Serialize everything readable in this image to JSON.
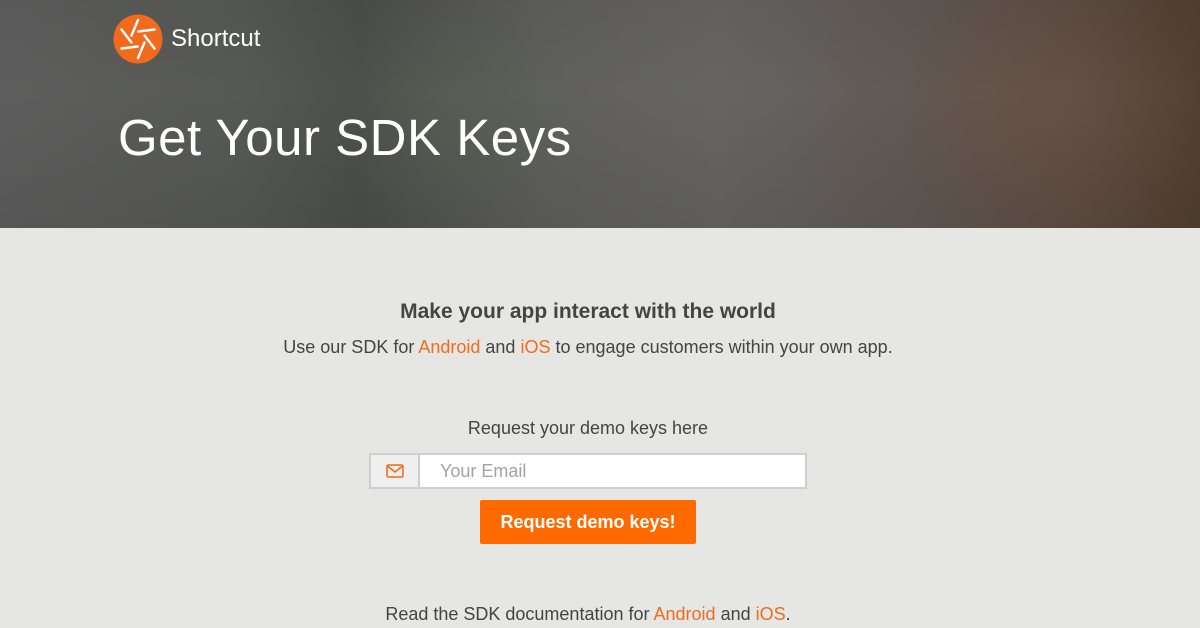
{
  "brand": {
    "name": "Shortcut",
    "logo_icon": "aperture-logo-icon",
    "logo_color": "#f26b1d"
  },
  "hero": {
    "title": "Get Your SDK Keys"
  },
  "intro": {
    "headline": "Make your app interact with the world",
    "prefix": "Use our SDK for",
    "android_link": "Android",
    "and": "and",
    "ios_link": "iOS",
    "suffix": "to engage customers within your own app."
  },
  "form": {
    "label": "Request your demo keys here",
    "email_icon": "envelope-icon",
    "email_placeholder": "Your Email",
    "email_value": "",
    "submit_label": "Request demo keys!"
  },
  "docs": {
    "prefix": "Read the SDK documentation for",
    "android_link": "Android",
    "and": "and",
    "ios_link": "iOS",
    "suffix": "."
  },
  "colors": {
    "accent": "#ff6a00",
    "link": "#f26b1d",
    "background": "#e6e6e4",
    "text": "#444444"
  }
}
